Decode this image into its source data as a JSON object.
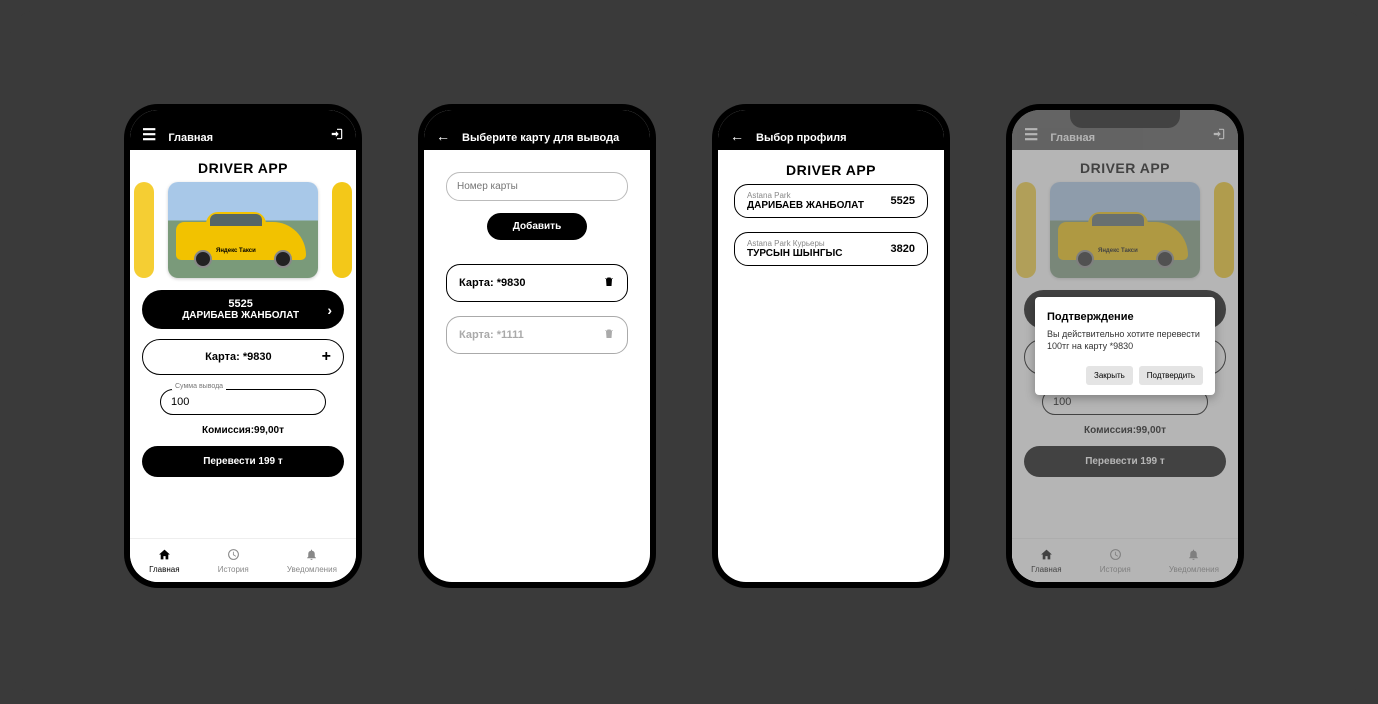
{
  "app_title": "DRIVER APP",
  "screen1": {
    "header_title": "Главная",
    "profile_code": "5525",
    "profile_name": "ДАРИБАЕВ ЖАНБОЛАТ",
    "card_label": "Карта: *9830",
    "amount_label": "Сумма вывода",
    "amount_value": "100",
    "commission": "Комиссия:99,00т",
    "transfer": "Перевести  199 т",
    "taxi_brand": "Яндекс Такси"
  },
  "screen2": {
    "header_title": "Выберите карту для вывода",
    "card_number_placeholder": "Номер карты",
    "add_button": "Добавить",
    "cards": [
      {
        "label": "Карта: *9830",
        "active": true
      },
      {
        "label": "Карта: *1111",
        "active": false
      }
    ]
  },
  "screen3": {
    "header_title": "Выбор профиля",
    "profiles": [
      {
        "company": "Astana Park",
        "name": "ДАРИБАЕВ ЖАНБОЛАТ",
        "code": "5525"
      },
      {
        "company": "Astana Park Курьеры",
        "name": "ТУРСЫН ШЫНГЫС",
        "code": "3820"
      }
    ]
  },
  "screen4": {
    "header_title": "Главная",
    "dialog_title": "Подтверждение",
    "dialog_text": "Вы действительно хотите перевести 100тг на карту *9830",
    "close": "Закрыть",
    "confirm": "Подтвердить"
  },
  "nav": {
    "home": "Главная",
    "history": "История",
    "notifications": "Уведомления"
  }
}
